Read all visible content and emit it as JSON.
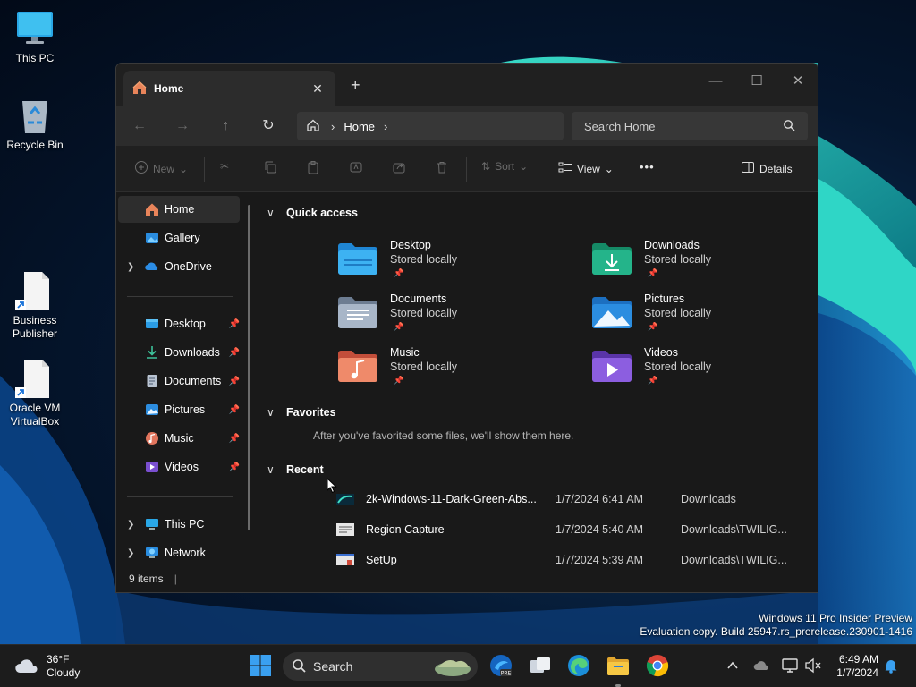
{
  "desktop": {
    "icons": [
      {
        "label": "This PC"
      },
      {
        "label": "Recycle Bin"
      },
      {
        "label": "Business Publisher"
      },
      {
        "label": "Oracle VM VirtualBox"
      }
    ],
    "watermark": {
      "line1": "Windows 11 Pro Insider Preview",
      "line2": "Evaluation copy. Build 25947.rs_prerelease.230901-1416"
    }
  },
  "explorer": {
    "tab": {
      "title": "Home",
      "close": "✕"
    },
    "new_tab": "+",
    "window_controls": {
      "minimize": "—",
      "maximize": "☐",
      "close": "✕"
    },
    "address": {
      "crumb": "Home"
    },
    "search": {
      "placeholder": "Search Home"
    },
    "commands": {
      "new": "New",
      "sort": "Sort",
      "view": "View",
      "more": "•••",
      "details": "Details"
    },
    "nav": {
      "home": "Home",
      "gallery": "Gallery",
      "onedrive": "OneDrive",
      "desktop": "Desktop",
      "downloads": "Downloads",
      "documents": "Documents",
      "pictures": "Pictures",
      "music": "Music",
      "videos": "Videos",
      "thispc": "This PC",
      "network": "Network"
    },
    "sections": {
      "quick_access": "Quick access",
      "favorites": "Favorites",
      "favorites_empty": "After you've favorited some files, we'll show them here.",
      "recent": "Recent"
    },
    "quick_access": [
      {
        "name": "Desktop",
        "status": "Stored locally",
        "color": "#2f9be0"
      },
      {
        "name": "Downloads",
        "status": "Stored locally",
        "color": "#1fa37a"
      },
      {
        "name": "Documents",
        "status": "Stored locally",
        "color": "#8a9bb0"
      },
      {
        "name": "Pictures",
        "status": "Stored locally",
        "color": "#2c8de0"
      },
      {
        "name": "Music",
        "status": "Stored locally",
        "color": "#e0745c"
      },
      {
        "name": "Videos",
        "status": "Stored locally",
        "color": "#7a4fd0"
      }
    ],
    "recent": [
      {
        "name": "2k-Windows-11-Dark-Green-Abs...",
        "date": "1/7/2024 6:41 AM",
        "location": "Downloads"
      },
      {
        "name": "Region Capture",
        "date": "1/7/2024 5:40 AM",
        "location": "Downloads\\TWILIG..."
      },
      {
        "name": "SetUp",
        "date": "1/7/2024 5:39 AM",
        "location": "Downloads\\TWILIG..."
      }
    ],
    "status": {
      "items": "9 items"
    }
  },
  "taskbar": {
    "weather": {
      "temp": "36°F",
      "condition": "Cloudy"
    },
    "search_label": "Search",
    "clock": {
      "time": "6:49 AM",
      "date": "1/7/2024"
    }
  }
}
